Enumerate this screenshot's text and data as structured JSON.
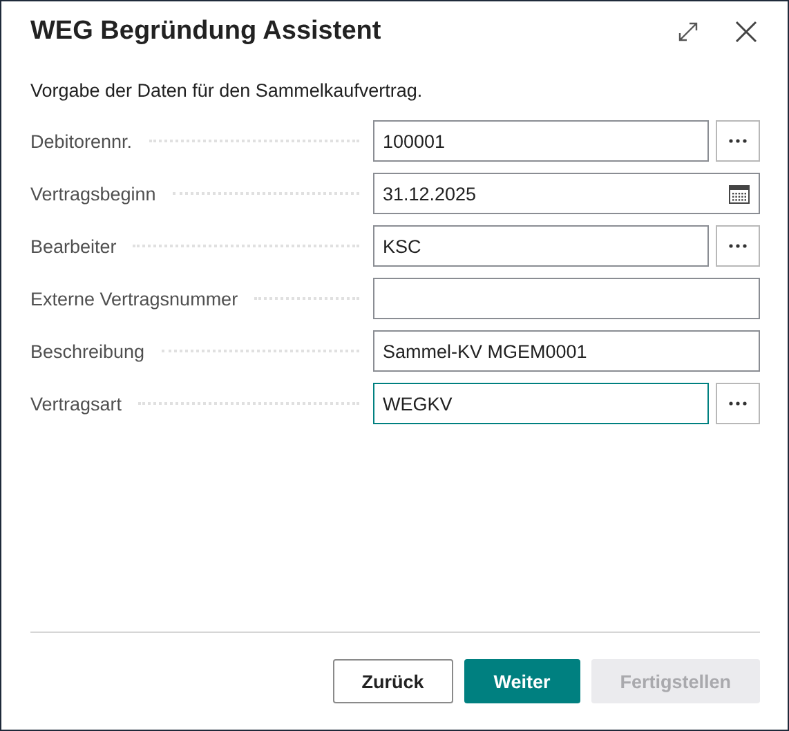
{
  "window": {
    "title": "WEG Begründung Assistent"
  },
  "description": "Vorgabe der Daten für den Sammelkaufvertrag.",
  "fields": [
    {
      "label": "Debitorennr.",
      "value": "100001",
      "kind": "lookup",
      "focused": false
    },
    {
      "label": "Vertragsbeginn",
      "value": "31.12.2025",
      "kind": "date",
      "focused": false
    },
    {
      "label": "Bearbeiter",
      "value": "KSC",
      "kind": "lookup",
      "focused": false
    },
    {
      "label": "Externe Vertragsnummer",
      "kind": "text",
      "focused": false
    },
    {
      "label": "Beschreibung",
      "value": "Sammel-KV MGEM0001",
      "kind": "text",
      "focused": false
    },
    {
      "label": "Vertragsart",
      "value": "WEGKV",
      "kind": "lookup",
      "focused": true
    }
  ],
  "buttons": [
    {
      "label": "Zurück",
      "kind": "default",
      "disabled": false
    },
    {
      "label": "Weiter",
      "kind": "primary",
      "disabled": false
    },
    {
      "label": "Fertigstellen",
      "kind": "default",
      "disabled": true
    }
  ]
}
